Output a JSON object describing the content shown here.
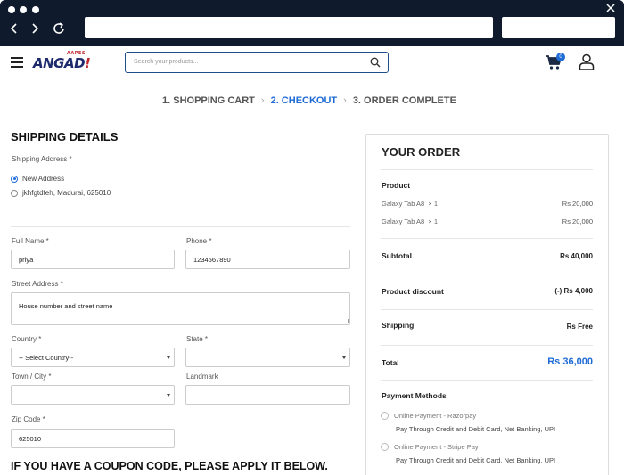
{
  "browser": {
    "dots": [
      "#ffffff",
      "#ffffff",
      "#ffffff"
    ]
  },
  "header": {
    "logo_small": "AAPES",
    "logo_main": "ANGAD",
    "logo_bang": "!",
    "search_placeholder": "Search your products...",
    "cart_count": "0"
  },
  "steps": {
    "step1": "1. SHOPPING CART",
    "step2": "2. CHECKOUT",
    "step3": "3. ORDER COMPLETE",
    "active": 2
  },
  "shipping": {
    "title": "SHIPPING DETAILS",
    "address_label": "Shipping Address *",
    "address_options": [
      {
        "label": "New Address",
        "checked": true
      },
      {
        "label": "jkhfgtdfeh, Madurai, 625010",
        "checked": false
      }
    ],
    "full_name_label": "Full Name *",
    "full_name_value": "priya",
    "phone_label": "Phone *",
    "phone_value": "1234567890",
    "street_label": "Street Address *",
    "street_placeholder": "House number and street name",
    "country_label": "Country *",
    "country_value": "-- Select Country--",
    "state_label": "State *",
    "state_value": "",
    "town_label": "Town / City *",
    "town_value": "",
    "landmark_label": "Landmark",
    "landmark_value": "",
    "zip_label": "Zip Code *",
    "zip_value": "625010",
    "coupon_heading": "IF YOU HAVE A COUPON CODE, PLEASE APPLY IT BELOW."
  },
  "order": {
    "title": "YOUR ORDER",
    "product_label": "Product",
    "items": [
      {
        "name": "Galaxy Tab A8",
        "qty": "× 1",
        "price": "Rs 20,000"
      },
      {
        "name": "Galaxy Tab A8",
        "qty": "× 1",
        "price": "Rs 20,000"
      }
    ],
    "subtotal_label": "Subtotal",
    "subtotal_value": "Rs 40,000",
    "discount_label": "Product discount",
    "discount_value": "(-) Rs 4,000",
    "shipping_label": "Shipping",
    "shipping_value": "Rs Free",
    "total_label": "Total",
    "total_value": "Rs 36,000",
    "payment_label": "Payment Methods",
    "payments": [
      {
        "name": "Online Payment - Razorpay",
        "desc": "Pay Through Credit and Debit Card, Net Banking, UPI"
      },
      {
        "name": "Online Payment - Stripe Pay",
        "desc": "Pay Through Credit and Debit Card, Net Banking, UPI"
      }
    ]
  },
  "colors": {
    "accent": "#1e6bd6",
    "chrome": "#0f1b2d",
    "brand_navy": "#1d2a6b",
    "brand_red": "#c0262d"
  }
}
